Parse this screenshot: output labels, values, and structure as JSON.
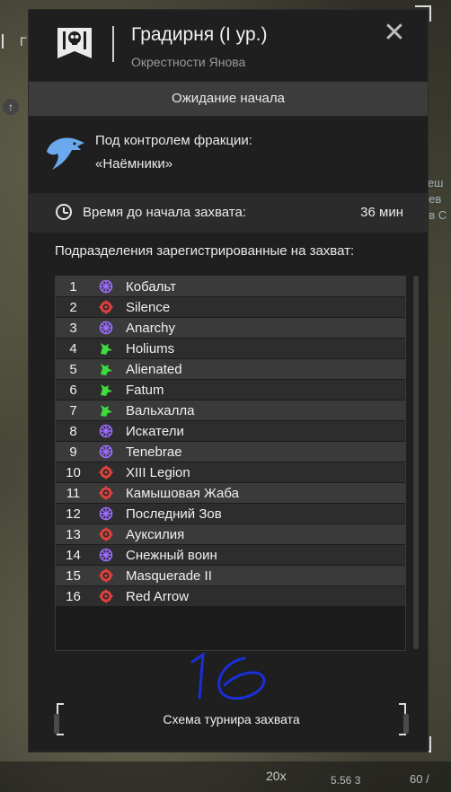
{
  "map": {
    "left_label": "Г",
    "right_labels": [
      "зеш",
      "нев",
      "ов С"
    ],
    "zoom": "20x",
    "coordinates": "5.56 3",
    "fps": "60 /"
  },
  "header": {
    "title": "Градирня (I ур.)",
    "subtitle": "Окрестности Янова",
    "close_label": "✕"
  },
  "status": "Ожидание начала",
  "faction": {
    "label": "Под контролем фракции:",
    "name": "«Наёмники»"
  },
  "capture_time": {
    "label": "Время до начала захвата:",
    "value": "36 мин"
  },
  "units": {
    "heading": "Подразделения зарегистрированные на захват:",
    "rows": [
      {
        "num": "1",
        "name": "Кобальт",
        "icon": "purple-wheel-icon"
      },
      {
        "num": "2",
        "name": "Silence",
        "icon": "red-gear-icon"
      },
      {
        "num": "3",
        "name": "Anarchy",
        "icon": "purple-wheel-icon"
      },
      {
        "num": "4",
        "name": "Holiums",
        "icon": "green-wolf-icon"
      },
      {
        "num": "5",
        "name": "Alienated",
        "icon": "green-wolf-icon"
      },
      {
        "num": "6",
        "name": "Fatum",
        "icon": "green-wolf-icon"
      },
      {
        "num": "7",
        "name": "Вальхалла",
        "icon": "green-wolf-icon"
      },
      {
        "num": "8",
        "name": "Искатели",
        "icon": "purple-wheel-icon"
      },
      {
        "num": "9",
        "name": "Tenebrae",
        "icon": "purple-wheel-icon"
      },
      {
        "num": "10",
        "name": "XIII Legion",
        "icon": "red-gear-icon"
      },
      {
        "num": "11",
        "name": "Камышовая Жаба",
        "icon": "red-gear-icon"
      },
      {
        "num": "12",
        "name": "Последний Зов",
        "icon": "purple-wheel-icon"
      },
      {
        "num": "13",
        "name": "Ауксилия",
        "icon": "red-gear-icon"
      },
      {
        "num": "14",
        "name": "Снежный воин",
        "icon": "purple-wheel-icon"
      },
      {
        "num": "15",
        "name": "Masquerade II",
        "icon": "red-gear-icon"
      },
      {
        "num": "16",
        "name": "Red Arrow",
        "icon": "red-gear-icon"
      }
    ]
  },
  "handwritten_note": "16",
  "scheme_button": "Схема турнира захвата",
  "colors": {
    "purple": "#9b6bff",
    "red": "#e0413c",
    "green": "#3ddc3d",
    "handwriting": "#1a2fd6",
    "faction_blue": "#6aa9ee"
  }
}
